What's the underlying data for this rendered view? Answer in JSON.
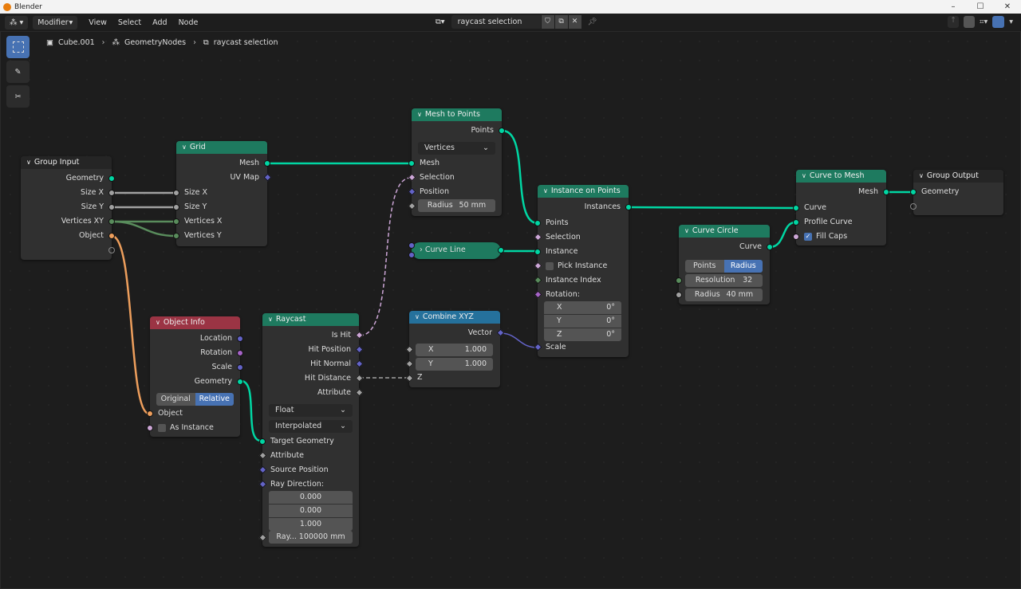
{
  "window": {
    "title": "Blender",
    "minimize": "–",
    "maximize": "☐",
    "close": "✕"
  },
  "header": {
    "editor_icon": "node-editor-icon",
    "mode": "Modifier",
    "menus": [
      "View",
      "Select",
      "Add",
      "Node"
    ],
    "datablock": "raycast selection"
  },
  "breadcrumb": {
    "object": "Cube.001",
    "modifier": "GeometryNodes",
    "tree": "raycast selection"
  },
  "colors": {
    "geometry": "#00d6a3",
    "float": "#a1a1a1",
    "int": "#598c5c",
    "vector": "#6363c7",
    "bool": "#cca6d6",
    "object": "#ed9e5c",
    "rotation": "#a663c7",
    "accent": "#4772b3"
  },
  "nodes": {
    "group_input": {
      "title": "Group Input",
      "outputs": [
        "Geometry",
        "Size X",
        "Size Y",
        "Vertices XY",
        "Object"
      ]
    },
    "grid": {
      "title": "Grid",
      "outputs": [
        "Mesh",
        "UV Map"
      ],
      "inputs": [
        "Size X",
        "Size Y",
        "Vertices X",
        "Vertices Y"
      ]
    },
    "mesh_to_points": {
      "title": "Mesh to Points",
      "outputs": [
        "Points"
      ],
      "mode": "Vertices",
      "inputs": [
        "Mesh",
        "Selection",
        "Position"
      ],
      "radius_label": "Radius",
      "radius_value": "50 mm"
    },
    "instance_on_points": {
      "title": "Instance on Points",
      "outputs": [
        "Instances"
      ],
      "inputs": [
        "Points",
        "Selection",
        "Instance",
        "Pick Instance",
        "Instance Index",
        "Rotation:",
        "Scale"
      ],
      "rotation": [
        {
          "axis": "X",
          "value": "0°"
        },
        {
          "axis": "Y",
          "value": "0°"
        },
        {
          "axis": "Z",
          "value": "0°"
        }
      ]
    },
    "curve_line": {
      "title": "Curve Line"
    },
    "curve_circle": {
      "title": "Curve Circle",
      "outputs": [
        "Curve"
      ],
      "mode_options": [
        "Points",
        "Radius"
      ],
      "mode_selected": "Radius",
      "resolution_label": "Resolution",
      "resolution_value": "32",
      "radius_label": "Radius",
      "radius_value": "40 mm"
    },
    "curve_to_mesh": {
      "title": "Curve to Mesh",
      "outputs": [
        "Mesh"
      ],
      "inputs": [
        "Curve",
        "Profile Curve",
        "Fill Caps"
      ],
      "fill_caps": true
    },
    "group_output": {
      "title": "Group Output",
      "inputs": [
        "Geometry"
      ]
    },
    "object_info": {
      "title": "Object Info",
      "outputs": [
        "Location",
        "Rotation",
        "Scale",
        "Geometry"
      ],
      "mode_options": [
        "Original",
        "Relative"
      ],
      "mode_selected": "Relative",
      "inputs": [
        "Object",
        "As Instance"
      ]
    },
    "raycast": {
      "title": "Raycast",
      "outputs": [
        "Is Hit",
        "Hit Position",
        "Hit Normal",
        "Hit Distance",
        "Attribute"
      ],
      "data_type": "Float",
      "mapping": "Interpolated",
      "inputs": [
        "Target Geometry",
        "Attribute",
        "Source Position",
        "Ray Direction:"
      ],
      "ray_direction": [
        "0.000",
        "0.000",
        "1.000"
      ],
      "ray_length_label": "Ray...",
      "ray_length_value": "100000 mm"
    },
    "combine_xyz": {
      "title": "Combine XYZ",
      "outputs": [
        "Vector"
      ],
      "x_label": "X",
      "x_value": "1.000",
      "y_label": "Y",
      "y_value": "1.000",
      "z_label": "Z"
    }
  }
}
